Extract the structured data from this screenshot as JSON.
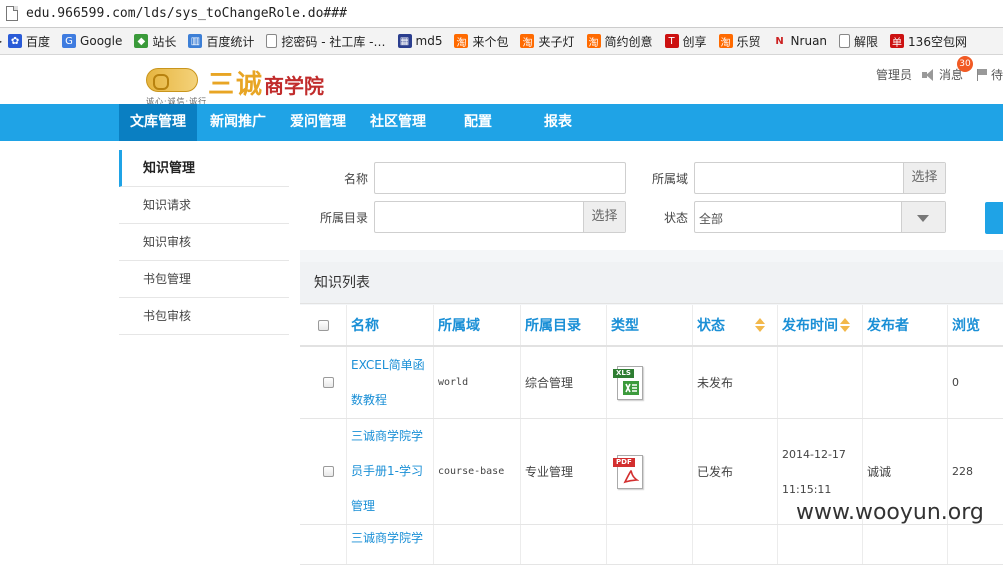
{
  "browser": {
    "url": "edu.966599.com/lds/sys_toChangeRole.do###",
    "bookmarks": [
      {
        "label": "百度",
        "icon": "baidu-paw-icon",
        "color": "#2a5bd7"
      },
      {
        "label": "Google",
        "icon": "google-icon",
        "color": "#3f7ce0"
      },
      {
        "label": "站长",
        "icon": "zhanzhang-icon",
        "color": "#3a9a3a"
      },
      {
        "label": "百度统计",
        "icon": "chart-icon",
        "color": "#3d7fd6"
      },
      {
        "label": "挖密码 - 社工库 -…",
        "icon": "page-icon",
        "color": "#888888"
      },
      {
        "label": "md5",
        "icon": "grid-icon",
        "color": "#2b3e8e"
      },
      {
        "label": "来个包",
        "icon": "taobao-icon",
        "color": "#ff6a00"
      },
      {
        "label": "夹子灯",
        "icon": "taobao-icon",
        "color": "#ff6a00"
      },
      {
        "label": "简约创意",
        "icon": "taobao-icon",
        "color": "#ff6a00"
      },
      {
        "label": "创享",
        "icon": "t-icon",
        "color": "#cc1111"
      },
      {
        "label": "乐贸",
        "icon": "taobao-icon",
        "color": "#ff6a00"
      },
      {
        "label": "Nruan",
        "icon": "n-icon",
        "color": "#cc2222"
      },
      {
        "label": "解限",
        "icon": "page-icon",
        "color": "#888888"
      },
      {
        "label": "136空包网",
        "icon": "dan-icon",
        "color": "#cc1111"
      }
    ]
  },
  "header": {
    "brand": "三诚",
    "brand_sub": "商学院",
    "slogan": "诚心·诚信·诚行",
    "admin": "管理员",
    "messages": "消息",
    "badge": "30",
    "extra": "待"
  },
  "nav": {
    "tabs": [
      "文库管理",
      "新闻推广",
      "爱问管理",
      "社区管理",
      "配置",
      "报表"
    ]
  },
  "sidebar": {
    "items": [
      "知识管理",
      "知识请求",
      "知识审核",
      "书包管理",
      "书包审核"
    ]
  },
  "search": {
    "name_label": "名称",
    "domain_label": "所属域",
    "dir_label": "所属目录",
    "status_label": "状态",
    "select_button": "选择",
    "status_value": "全部"
  },
  "list": {
    "title": "知识列表",
    "columns": [
      "名称",
      "所属域",
      "所属目录",
      "类型",
      "状态",
      "发布时间",
      "发布者",
      "浏览"
    ],
    "rows": [
      {
        "name": "EXCEL简单函数教程",
        "domain": "world",
        "dir": "综合管理",
        "type": "XLS",
        "status": "未发布",
        "time": "",
        "publisher": "",
        "views": "0"
      },
      {
        "name": "三诚商学院学员手册1-学习管理",
        "domain": "course-base",
        "dir": "专业管理",
        "type": "PDF",
        "status": "已发布",
        "time": "2014-12-17 11:15:11",
        "publisher": "诚诚",
        "views": "228"
      },
      {
        "name": "三诚商学院学",
        "domain": "",
        "dir": "",
        "type": "",
        "status": "",
        "time": "",
        "publisher": "",
        "views": ""
      }
    ]
  },
  "watermark": "www.wooyun.org"
}
